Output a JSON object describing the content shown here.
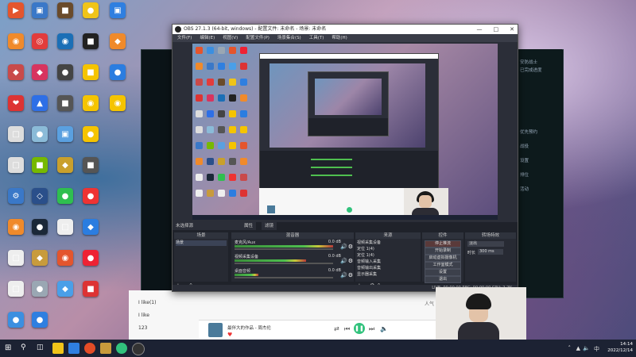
{
  "desktop_icons": [
    {
      "name": "icon-1",
      "label": "",
      "color": "#e4552d",
      "glyph": "▶"
    },
    {
      "name": "icon-2",
      "label": "",
      "color": "#f08a2b",
      "glyph": "◉"
    },
    {
      "name": "icon-3",
      "label": "",
      "color": "#c94a4a",
      "glyph": "◆"
    },
    {
      "name": "icon-4",
      "label": "",
      "color": "#d33",
      "glyph": "❤"
    },
    {
      "name": "icon-5",
      "label": "",
      "color": "#ddd",
      "glyph": "□"
    },
    {
      "name": "icon-6",
      "label": "",
      "color": "#ddd",
      "glyph": "□"
    },
    {
      "name": "icon-7",
      "label": "",
      "color": "#3a78c8",
      "glyph": "⚙"
    },
    {
      "name": "icon-8",
      "label": "",
      "color": "#f08a2b",
      "glyph": "◉"
    },
    {
      "name": "icon-9",
      "label": "",
      "color": "#eee",
      "glyph": "□"
    },
    {
      "name": "icon-10",
      "label": "",
      "color": "#eee",
      "glyph": "□"
    },
    {
      "name": "icon-11",
      "label": "",
      "color": "#3b8fe0",
      "glyph": "●"
    },
    {
      "name": "icon-12",
      "label": "",
      "color": "#3a78c8",
      "glyph": "▣"
    },
    {
      "name": "icon-13",
      "label": "",
      "color": "#e23c3c",
      "glyph": "◎"
    },
    {
      "name": "icon-14",
      "label": "",
      "color": "#d8345f",
      "glyph": "◆"
    },
    {
      "name": "icon-15",
      "label": "",
      "color": "#2e6fe6",
      "glyph": "▲"
    },
    {
      "name": "icon-16",
      "label": "",
      "color": "#8bbbd8",
      "glyph": "●"
    },
    {
      "name": "icon-17",
      "label": "",
      "color": "#76b900",
      "glyph": "■"
    },
    {
      "name": "icon-18",
      "label": "",
      "color": "#2a4f8a",
      "glyph": "◇"
    },
    {
      "name": "icon-19",
      "label": "",
      "color": "#1b2838",
      "glyph": "●"
    },
    {
      "name": "icon-20",
      "label": "",
      "color": "#c89b3c",
      "glyph": "◆"
    },
    {
      "name": "icon-21",
      "label": "",
      "color": "#9aa7b3",
      "glyph": "●"
    },
    {
      "name": "icon-22",
      "label": "",
      "color": "#2f7fe0",
      "glyph": "●"
    },
    {
      "name": "icon-23",
      "label": "",
      "color": "#6a4b2a",
      "glyph": "■"
    },
    {
      "name": "icon-24",
      "label": "",
      "color": "#1b6fb6",
      "glyph": "◉"
    },
    {
      "name": "icon-25",
      "label": "",
      "color": "#444",
      "glyph": "●"
    },
    {
      "name": "icon-26",
      "label": "",
      "color": "#555",
      "glyph": "■"
    },
    {
      "name": "icon-27",
      "label": "",
      "color": "#5aa0e0",
      "glyph": "▣"
    },
    {
      "name": "icon-28",
      "label": "",
      "color": "#c9a02c",
      "glyph": "◆"
    },
    {
      "name": "icon-29",
      "label": "",
      "color": "#2fbf4f",
      "glyph": "●"
    },
    {
      "name": "icon-30",
      "label": "",
      "color": "#eee",
      "glyph": "□"
    },
    {
      "name": "icon-31",
      "label": "",
      "color": "#e4552d",
      "glyph": "◉"
    },
    {
      "name": "icon-32",
      "label": "",
      "color": "#4a9fe8",
      "glyph": "◆"
    },
    {
      "name": "icon-33",
      "label": "",
      "color": "#f0c419",
      "glyph": "●"
    },
    {
      "name": "icon-34",
      "label": "",
      "color": "#222",
      "glyph": "■"
    },
    {
      "name": "icon-35",
      "label": "",
      "color": "#f5c400",
      "glyph": "■"
    },
    {
      "name": "icon-36",
      "label": "",
      "color": "#f5c400",
      "glyph": "◉"
    },
    {
      "name": "icon-37",
      "label": "",
      "color": "#f5c400",
      "glyph": "●"
    },
    {
      "name": "icon-38",
      "label": "",
      "color": "#555",
      "glyph": "■"
    },
    {
      "name": "icon-39",
      "label": "",
      "color": "#e33",
      "glyph": "●"
    },
    {
      "name": "icon-40",
      "label": "",
      "color": "#2b7de0",
      "glyph": "◆"
    },
    {
      "name": "icon-41",
      "label": "",
      "color": "#e23",
      "glyph": "●"
    },
    {
      "name": "icon-42",
      "label": "",
      "color": "#d33",
      "glyph": "■"
    },
    {
      "name": "icon-43",
      "label": "",
      "color": "#2f7fe0",
      "glyph": "▣"
    },
    {
      "name": "icon-44",
      "label": "",
      "color": "#f08a2b",
      "glyph": "◆"
    },
    {
      "name": "icon-45",
      "label": "",
      "color": "#2b7de0",
      "glyph": "●"
    },
    {
      "name": "icon-46",
      "label": "",
      "color": "#f5c400",
      "glyph": "◉"
    }
  ],
  "obs": {
    "title": "OBS 27.1.3 (64-bit, windows) - 配置文件: 未命名 - 场景: 未命名",
    "menu": [
      "文件(F)",
      "编辑(E)",
      "视图(V)",
      "配置文件(P)",
      "场景集合(S)",
      "工具(T)",
      "帮助(H)"
    ],
    "tabs": [
      "未选择源",
      "属性",
      "滤镜"
    ],
    "panels": {
      "scenes": {
        "header": "场景",
        "items": [
          "场景"
        ]
      },
      "sources": {
        "header": "来源",
        "items": [
          "视频采集设备",
          "定位 1(4)",
          "定位 1(4)",
          "音频输入采集",
          "音频输出采集",
          "显示器采集"
        ]
      },
      "mixer": {
        "header": "混音器",
        "channels": [
          {
            "name": "桌面音频",
            "db": "0.0 dB"
          },
          {
            "name": "麦克风/Aux",
            "db": "0.0 dB"
          },
          {
            "name": "视频采集设备",
            "db": "0.0 dB"
          }
        ]
      },
      "transitions": {
        "header": "转场特效",
        "mode": "淡出",
        "duration_label": "时长",
        "duration": "300 ms"
      },
      "controls": {
        "header": "控件",
        "buttons": [
          "停止推流",
          "开始录制",
          "启动虚拟摄像机",
          "工作室模式",
          "设置",
          "退出"
        ]
      }
    },
    "status": "LIVE: 00:00:00  REC: 00:00:00  CPU: 2.2%"
  },
  "lol": {
    "title": "安防战士",
    "sub": "已完成进度",
    "items": [
      "优先预约",
      "战役",
      "设置",
      "排位",
      "活动"
    ]
  },
  "music": {
    "rows": [
      "I like(1)",
      "I like",
      "123"
    ],
    "track": "最伴大的作品 - 周杰伦",
    "right": "人气"
  },
  "tray": {
    "time": "14:14",
    "date": "2022/12/14"
  }
}
